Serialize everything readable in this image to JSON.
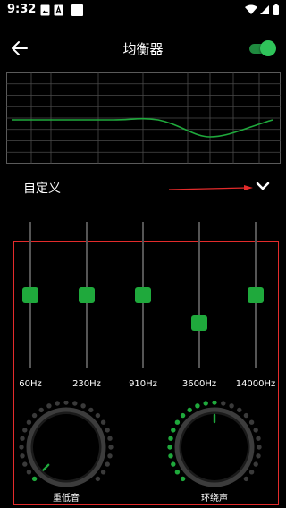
{
  "status": {
    "time": "9:32",
    "left_icons": [
      "photo-icon",
      "text-a-icon",
      "square-icon"
    ],
    "right_icons": [
      "wifi-icon",
      "signal-icon",
      "battery-icon"
    ]
  },
  "header": {
    "title": "均衡器",
    "back_icon": "arrow-left-icon",
    "enabled": true
  },
  "preset": {
    "label": "自定义",
    "icon": "chevron-down-icon"
  },
  "bands": [
    {
      "label": "60Hz",
      "level": 0.5
    },
    {
      "label": "230Hz",
      "level": 0.5
    },
    {
      "label": "910Hz",
      "level": 0.5
    },
    {
      "label": "3600Hz",
      "level": 0.31
    },
    {
      "label": "14000Hz",
      "level": 0.5
    }
  ],
  "knobs": [
    {
      "label": "重低音",
      "level": 0.0
    },
    {
      "label": "环绕声",
      "level": 0.5
    }
  ],
  "colors": {
    "accent": "#1fa93c",
    "highlight": "#e32b2b",
    "background": "#000000",
    "grid": "#5a5a5a",
    "dot_off": "#3a3a3a"
  }
}
